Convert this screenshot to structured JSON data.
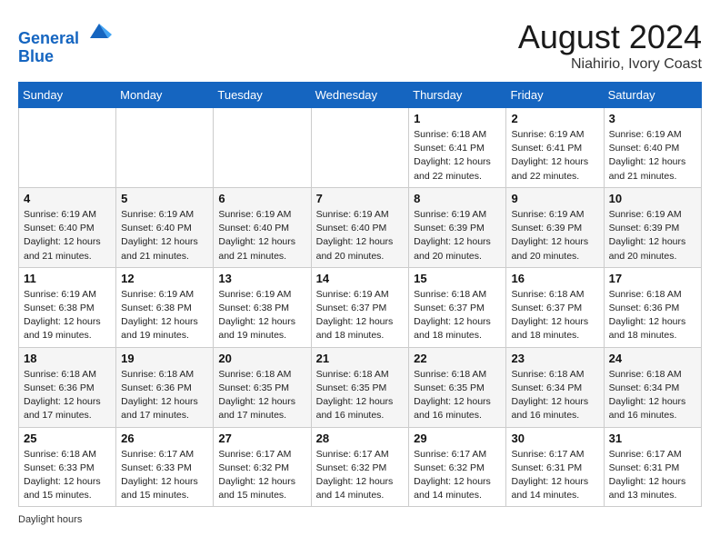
{
  "header": {
    "logo_line1": "General",
    "logo_line2": "Blue",
    "month": "August 2024",
    "location": "Niahirio, Ivory Coast"
  },
  "days_of_week": [
    "Sunday",
    "Monday",
    "Tuesday",
    "Wednesday",
    "Thursday",
    "Friday",
    "Saturday"
  ],
  "footer": {
    "daylight_label": "Daylight hours"
  },
  "weeks": [
    {
      "days": [
        {
          "num": "",
          "info": ""
        },
        {
          "num": "",
          "info": ""
        },
        {
          "num": "",
          "info": ""
        },
        {
          "num": "",
          "info": ""
        },
        {
          "num": "1",
          "info": "Sunrise: 6:18 AM\nSunset: 6:41 PM\nDaylight: 12 hours\nand 22 minutes."
        },
        {
          "num": "2",
          "info": "Sunrise: 6:19 AM\nSunset: 6:41 PM\nDaylight: 12 hours\nand 22 minutes."
        },
        {
          "num": "3",
          "info": "Sunrise: 6:19 AM\nSunset: 6:40 PM\nDaylight: 12 hours\nand 21 minutes."
        }
      ]
    },
    {
      "days": [
        {
          "num": "4",
          "info": "Sunrise: 6:19 AM\nSunset: 6:40 PM\nDaylight: 12 hours\nand 21 minutes."
        },
        {
          "num": "5",
          "info": "Sunrise: 6:19 AM\nSunset: 6:40 PM\nDaylight: 12 hours\nand 21 minutes."
        },
        {
          "num": "6",
          "info": "Sunrise: 6:19 AM\nSunset: 6:40 PM\nDaylight: 12 hours\nand 21 minutes."
        },
        {
          "num": "7",
          "info": "Sunrise: 6:19 AM\nSunset: 6:40 PM\nDaylight: 12 hours\nand 20 minutes."
        },
        {
          "num": "8",
          "info": "Sunrise: 6:19 AM\nSunset: 6:39 PM\nDaylight: 12 hours\nand 20 minutes."
        },
        {
          "num": "9",
          "info": "Sunrise: 6:19 AM\nSunset: 6:39 PM\nDaylight: 12 hours\nand 20 minutes."
        },
        {
          "num": "10",
          "info": "Sunrise: 6:19 AM\nSunset: 6:39 PM\nDaylight: 12 hours\nand 20 minutes."
        }
      ]
    },
    {
      "days": [
        {
          "num": "11",
          "info": "Sunrise: 6:19 AM\nSunset: 6:38 PM\nDaylight: 12 hours\nand 19 minutes."
        },
        {
          "num": "12",
          "info": "Sunrise: 6:19 AM\nSunset: 6:38 PM\nDaylight: 12 hours\nand 19 minutes."
        },
        {
          "num": "13",
          "info": "Sunrise: 6:19 AM\nSunset: 6:38 PM\nDaylight: 12 hours\nand 19 minutes."
        },
        {
          "num": "14",
          "info": "Sunrise: 6:19 AM\nSunset: 6:37 PM\nDaylight: 12 hours\nand 18 minutes."
        },
        {
          "num": "15",
          "info": "Sunrise: 6:18 AM\nSunset: 6:37 PM\nDaylight: 12 hours\nand 18 minutes."
        },
        {
          "num": "16",
          "info": "Sunrise: 6:18 AM\nSunset: 6:37 PM\nDaylight: 12 hours\nand 18 minutes."
        },
        {
          "num": "17",
          "info": "Sunrise: 6:18 AM\nSunset: 6:36 PM\nDaylight: 12 hours\nand 18 minutes."
        }
      ]
    },
    {
      "days": [
        {
          "num": "18",
          "info": "Sunrise: 6:18 AM\nSunset: 6:36 PM\nDaylight: 12 hours\nand 17 minutes."
        },
        {
          "num": "19",
          "info": "Sunrise: 6:18 AM\nSunset: 6:36 PM\nDaylight: 12 hours\nand 17 minutes."
        },
        {
          "num": "20",
          "info": "Sunrise: 6:18 AM\nSunset: 6:35 PM\nDaylight: 12 hours\nand 17 minutes."
        },
        {
          "num": "21",
          "info": "Sunrise: 6:18 AM\nSunset: 6:35 PM\nDaylight: 12 hours\nand 16 minutes."
        },
        {
          "num": "22",
          "info": "Sunrise: 6:18 AM\nSunset: 6:35 PM\nDaylight: 12 hours\nand 16 minutes."
        },
        {
          "num": "23",
          "info": "Sunrise: 6:18 AM\nSunset: 6:34 PM\nDaylight: 12 hours\nand 16 minutes."
        },
        {
          "num": "24",
          "info": "Sunrise: 6:18 AM\nSunset: 6:34 PM\nDaylight: 12 hours\nand 16 minutes."
        }
      ]
    },
    {
      "days": [
        {
          "num": "25",
          "info": "Sunrise: 6:18 AM\nSunset: 6:33 PM\nDaylight: 12 hours\nand 15 minutes."
        },
        {
          "num": "26",
          "info": "Sunrise: 6:17 AM\nSunset: 6:33 PM\nDaylight: 12 hours\nand 15 minutes."
        },
        {
          "num": "27",
          "info": "Sunrise: 6:17 AM\nSunset: 6:32 PM\nDaylight: 12 hours\nand 15 minutes."
        },
        {
          "num": "28",
          "info": "Sunrise: 6:17 AM\nSunset: 6:32 PM\nDaylight: 12 hours\nand 14 minutes."
        },
        {
          "num": "29",
          "info": "Sunrise: 6:17 AM\nSunset: 6:32 PM\nDaylight: 12 hours\nand 14 minutes."
        },
        {
          "num": "30",
          "info": "Sunrise: 6:17 AM\nSunset: 6:31 PM\nDaylight: 12 hours\nand 14 minutes."
        },
        {
          "num": "31",
          "info": "Sunrise: 6:17 AM\nSunset: 6:31 PM\nDaylight: 12 hours\nand 13 minutes."
        }
      ]
    }
  ]
}
